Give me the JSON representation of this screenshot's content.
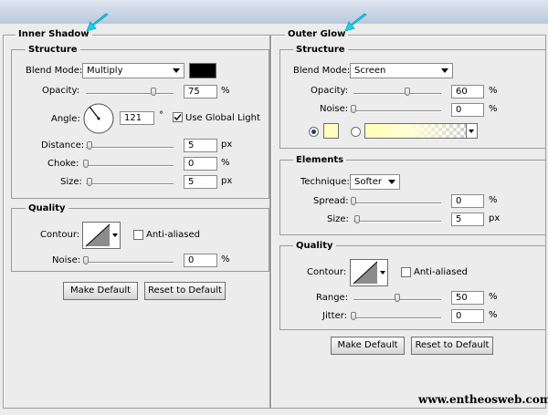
{
  "colors": {
    "shadow_swatch": "#000000",
    "glow_swatch": "#ffffc0",
    "cyan_arrow": "#1fd0f0"
  },
  "inner_shadow": {
    "title": "Inner Shadow",
    "structure": {
      "title": "Structure",
      "blend_mode_label": "Blend Mode:",
      "blend_mode_value": "Multiply",
      "opacity_label": "Opacity:",
      "opacity_value": "75",
      "opacity_level": 75,
      "opacity_unit": "%",
      "angle_label": "Angle:",
      "angle_value": "121",
      "angle_unit": "°",
      "use_global_light_label": "Use Global Light",
      "use_global_light_checked": true,
      "distance_label": "Distance:",
      "distance_value": "5",
      "distance_unit": "px",
      "choke_label": "Choke:",
      "choke_value": "0",
      "choke_unit": "%",
      "size_label": "Size:",
      "size_value": "5",
      "size_unit": "px"
    },
    "quality": {
      "title": "Quality",
      "contour_label": "Contour:",
      "anti_aliased_label": "Anti-aliased",
      "noise_label": "Noise:",
      "noise_value": "0",
      "noise_unit": "%"
    },
    "make_default_label": "Make Default",
    "reset_default_label": "Reset to Default"
  },
  "outer_glow": {
    "title": "Outer Glow",
    "structure": {
      "title": "Structure",
      "blend_mode_label": "Blend Mode:",
      "blend_mode_value": "Screen",
      "opacity_label": "Opacity:",
      "opacity_value": "60",
      "opacity_level": 60,
      "opacity_unit": "%",
      "noise_label": "Noise:",
      "noise_value": "0",
      "noise_unit": "%"
    },
    "elements": {
      "title": "Elements",
      "technique_label": "Technique:",
      "technique_value": "Softer",
      "spread_label": "Spread:",
      "spread_value": "0",
      "spread_unit": "%",
      "size_label": "Size:",
      "size_value": "5",
      "size_unit": "px"
    },
    "quality": {
      "title": "Quality",
      "contour_label": "Contour:",
      "anti_aliased_label": "Anti-aliased",
      "range_label": "Range:",
      "range_value": "50",
      "range_unit": "%",
      "jitter_label": "Jitter:",
      "jitter_value": "0",
      "jitter_unit": "%"
    },
    "make_default_label": "Make Default",
    "reset_default_label": "Reset to Default"
  },
  "watermark": "www.entheosweb.com"
}
